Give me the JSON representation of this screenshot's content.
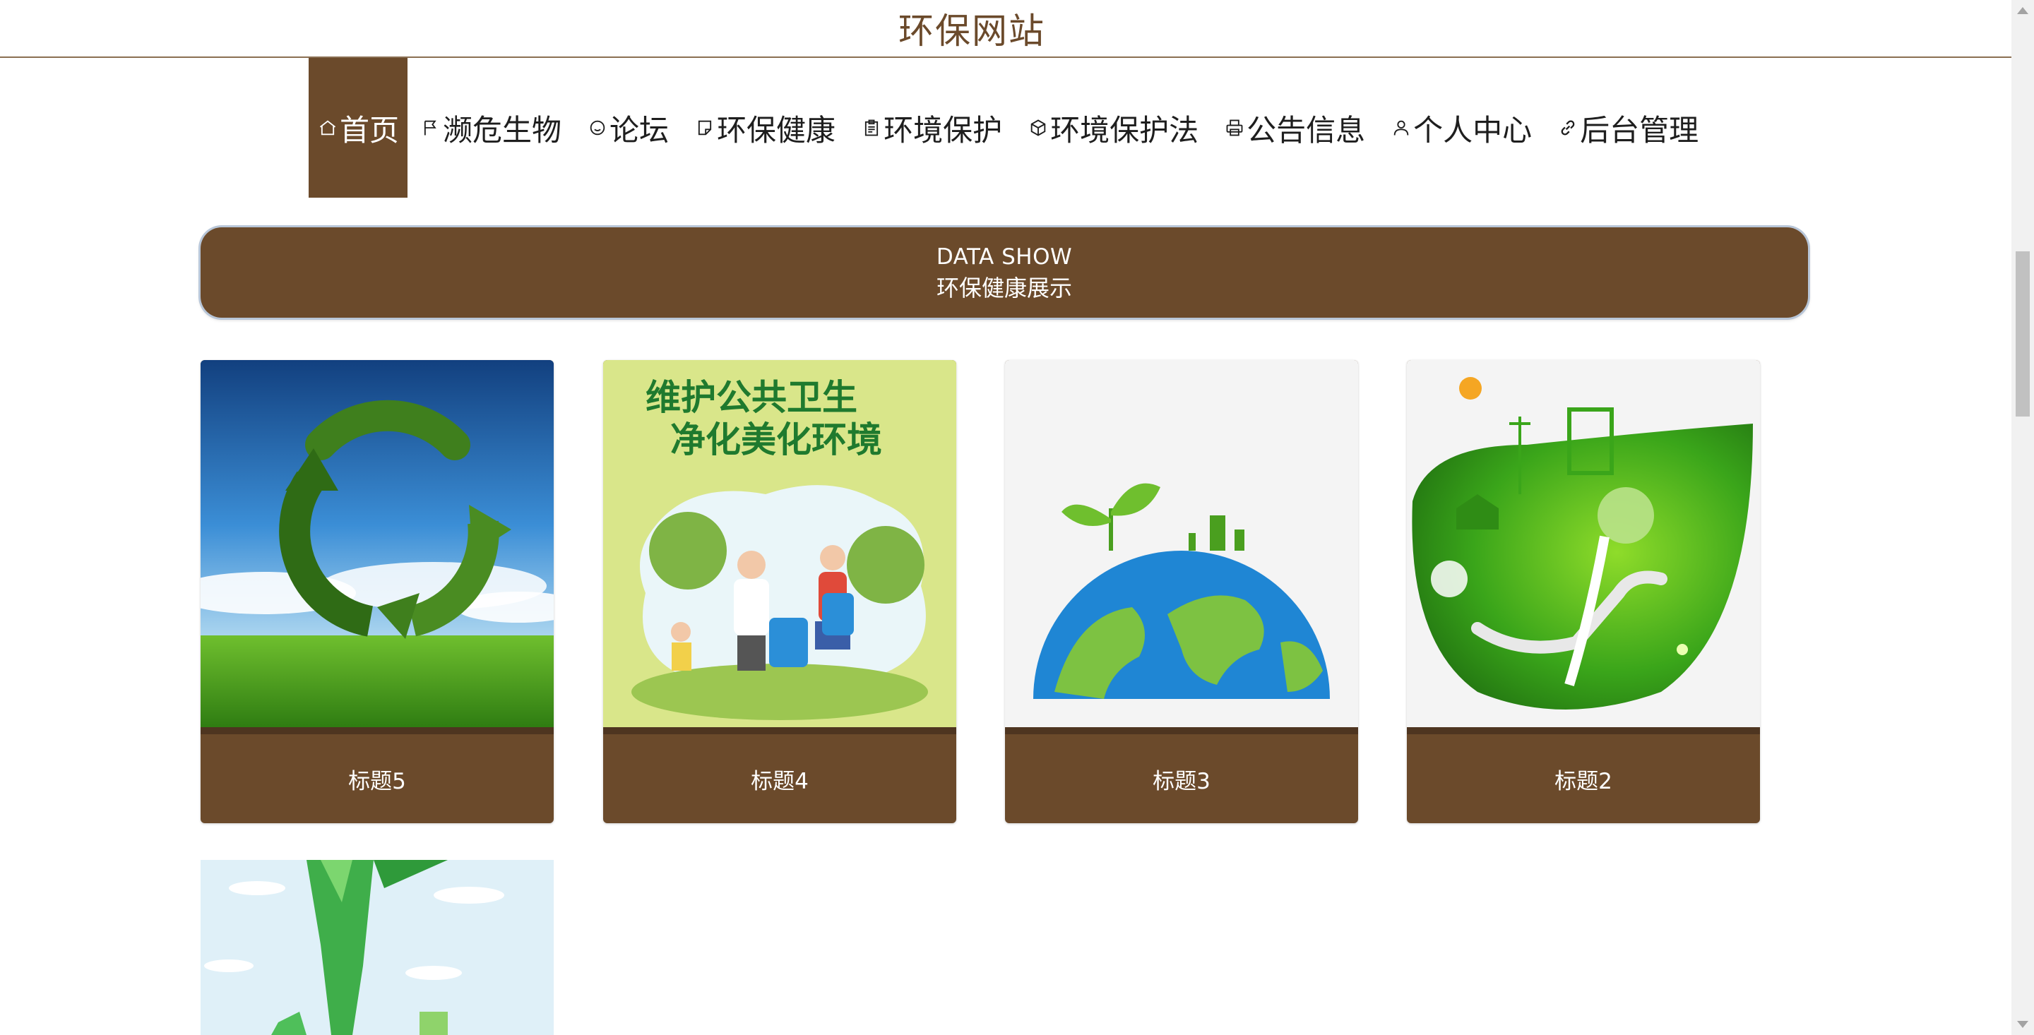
{
  "site": {
    "title": "环保网站"
  },
  "nav": {
    "items": [
      {
        "label": "首页",
        "icon": "home-icon",
        "active": true
      },
      {
        "label": "濒危生物",
        "icon": "flag-icon",
        "active": false
      },
      {
        "label": "论坛",
        "icon": "smile-icon",
        "active": false
      },
      {
        "label": "环保健康",
        "icon": "note-icon",
        "active": false
      },
      {
        "label": "环境保护",
        "icon": "clipboard-icon",
        "active": false
      },
      {
        "label": "环境保护法",
        "icon": "cube-icon",
        "active": false
      },
      {
        "label": "公告信息",
        "icon": "printer-icon",
        "active": false
      },
      {
        "label": "个人中心",
        "icon": "user-icon",
        "active": false
      },
      {
        "label": "后台管理",
        "icon": "link-icon",
        "active": false
      }
    ]
  },
  "banner": {
    "title_en": "DATA SHOW",
    "title_cn": "环保健康展示"
  },
  "cards": [
    {
      "title": "标题5",
      "image": "recycle-arrows-grass-sky"
    },
    {
      "title": "标题4",
      "image": "public-hygiene-poster",
      "poster_line1": "维护公共卫生",
      "poster_line2": "净化美化环境"
    },
    {
      "title": "标题3",
      "image": "green-earth-sprout"
    },
    {
      "title": "标题2",
      "image": "green-leaf-hands-city"
    },
    {
      "title": "",
      "image": "green-tree-sky-partial"
    }
  ],
  "colors": {
    "brand_brown": "#6b4a2b",
    "header_line": "#8a6f52"
  }
}
